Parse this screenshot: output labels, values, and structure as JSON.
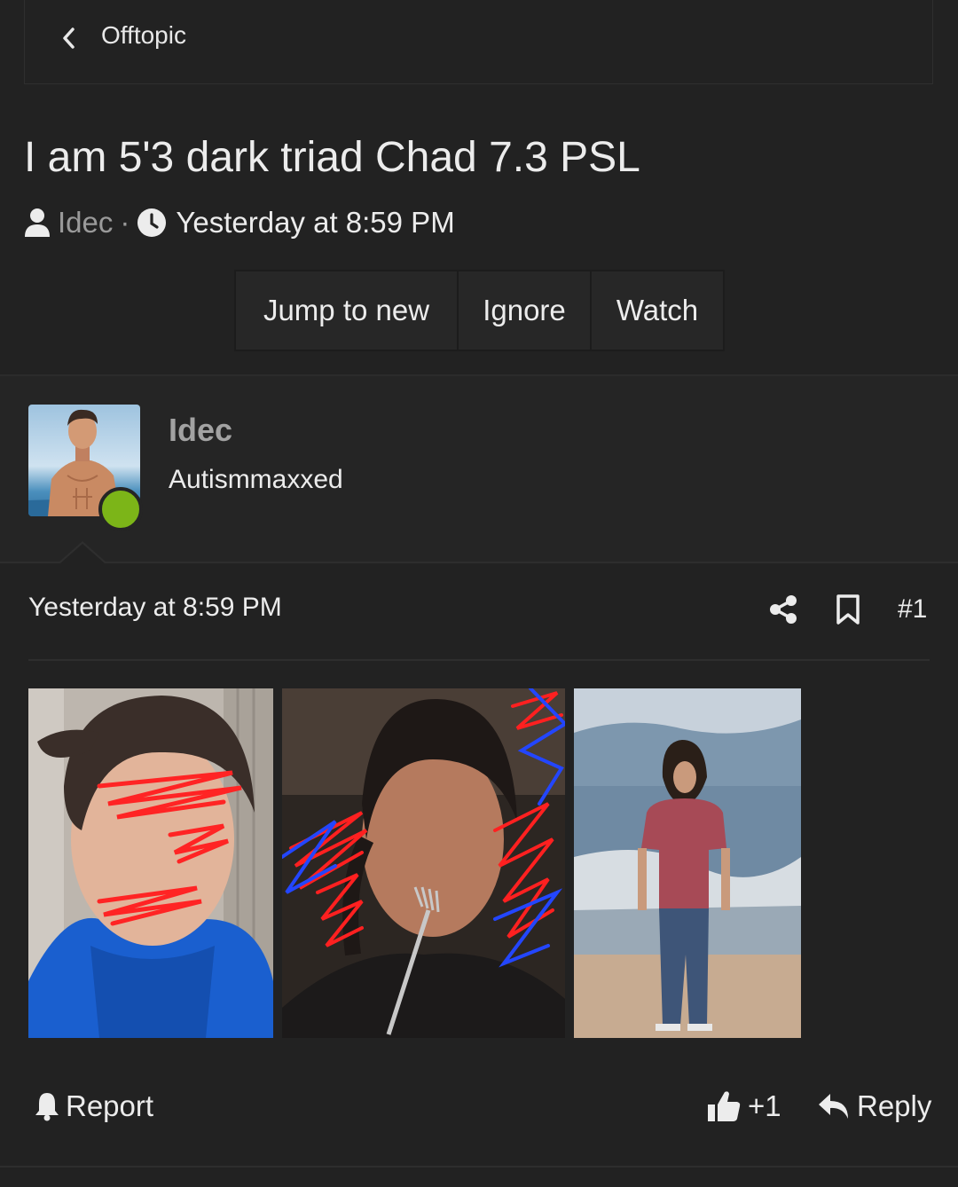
{
  "breadcrumb": {
    "label": "Offtopic"
  },
  "thread": {
    "title": "I am 5'3 dark triad Chad 7.3 PSL",
    "author": "Idec",
    "separator": "·",
    "date": "Yesterday at 8:59 PM"
  },
  "thread_buttons": {
    "jump_to_new": "Jump to new",
    "ignore": "Ignore",
    "watch": "Watch"
  },
  "post": {
    "user": {
      "name": "Idec",
      "title": "Autismmaxxed",
      "online": true
    },
    "date": "Yesterday at 8:59 PM",
    "number": "#1",
    "attachments": [
      "photo-selfie-blue-hoodie",
      "photo-fork-selfie",
      "photo-beach-standing"
    ],
    "actions": {
      "report": "Report",
      "like_count": "+1",
      "reply": "Reply"
    }
  },
  "colors": {
    "background": "#222222",
    "panel": "#252525",
    "button": "#272727",
    "online": "#7cb518",
    "muted_text": "#9a9a9a",
    "scribble_red": "#ff2222",
    "scribble_blue": "#2244ff"
  },
  "icons": [
    "chevron-left-icon",
    "user-icon",
    "clock-icon",
    "share-icon",
    "bookmark-icon",
    "bell-icon",
    "thumbs-up-icon",
    "reply-icon"
  ]
}
